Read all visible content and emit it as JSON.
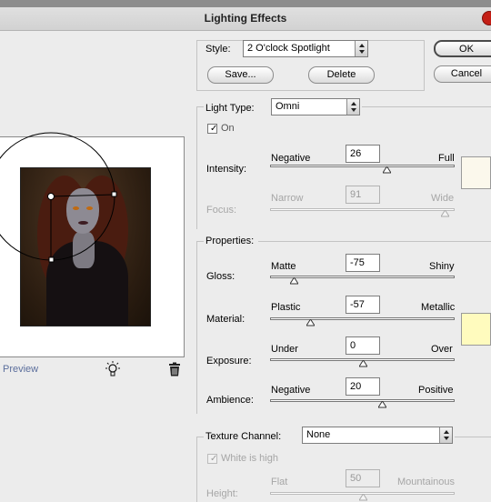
{
  "window": {
    "title": "Lighting Effects"
  },
  "preview": {
    "label": "Preview"
  },
  "style": {
    "label": "Style:",
    "value": "2 O'clock Spotlight",
    "save": "Save...",
    "delete": "Delete"
  },
  "dialog_buttons": {
    "ok": "OK",
    "cancel": "Cancel"
  },
  "light_type": {
    "label": "Light Type:",
    "value": "Omni",
    "on_label": "On",
    "on_checked": true
  },
  "intensity": {
    "label": "Intensity:",
    "min_label": "Negative",
    "max_label": "Full",
    "value": "26",
    "swatch_color": "#fbf8ec"
  },
  "focus": {
    "label": "Focus:",
    "min_label": "Narrow",
    "max_label": "Wide",
    "value": "91"
  },
  "properties": {
    "section_label": "Properties:",
    "gloss": {
      "label": "Gloss:",
      "min_label": "Matte",
      "max_label": "Shiny",
      "value": "-75"
    },
    "material": {
      "label": "Material:",
      "min_label": "Plastic",
      "max_label": "Metallic",
      "value": "-57"
    },
    "exposure": {
      "label": "Exposure:",
      "min_label": "Under",
      "max_label": "Over",
      "value": "0"
    },
    "ambience": {
      "label": "Ambience:",
      "min_label": "Negative",
      "max_label": "Positive",
      "value": "20"
    },
    "swatch_color": "#fffbbe"
  },
  "texture": {
    "label": "Texture Channel:",
    "value": "None",
    "white_is_high_label": "White is high",
    "white_is_high_checked": true,
    "height_label": "Height:",
    "min_label": "Flat",
    "max_label": "Mountainous",
    "height_value": "50"
  }
}
